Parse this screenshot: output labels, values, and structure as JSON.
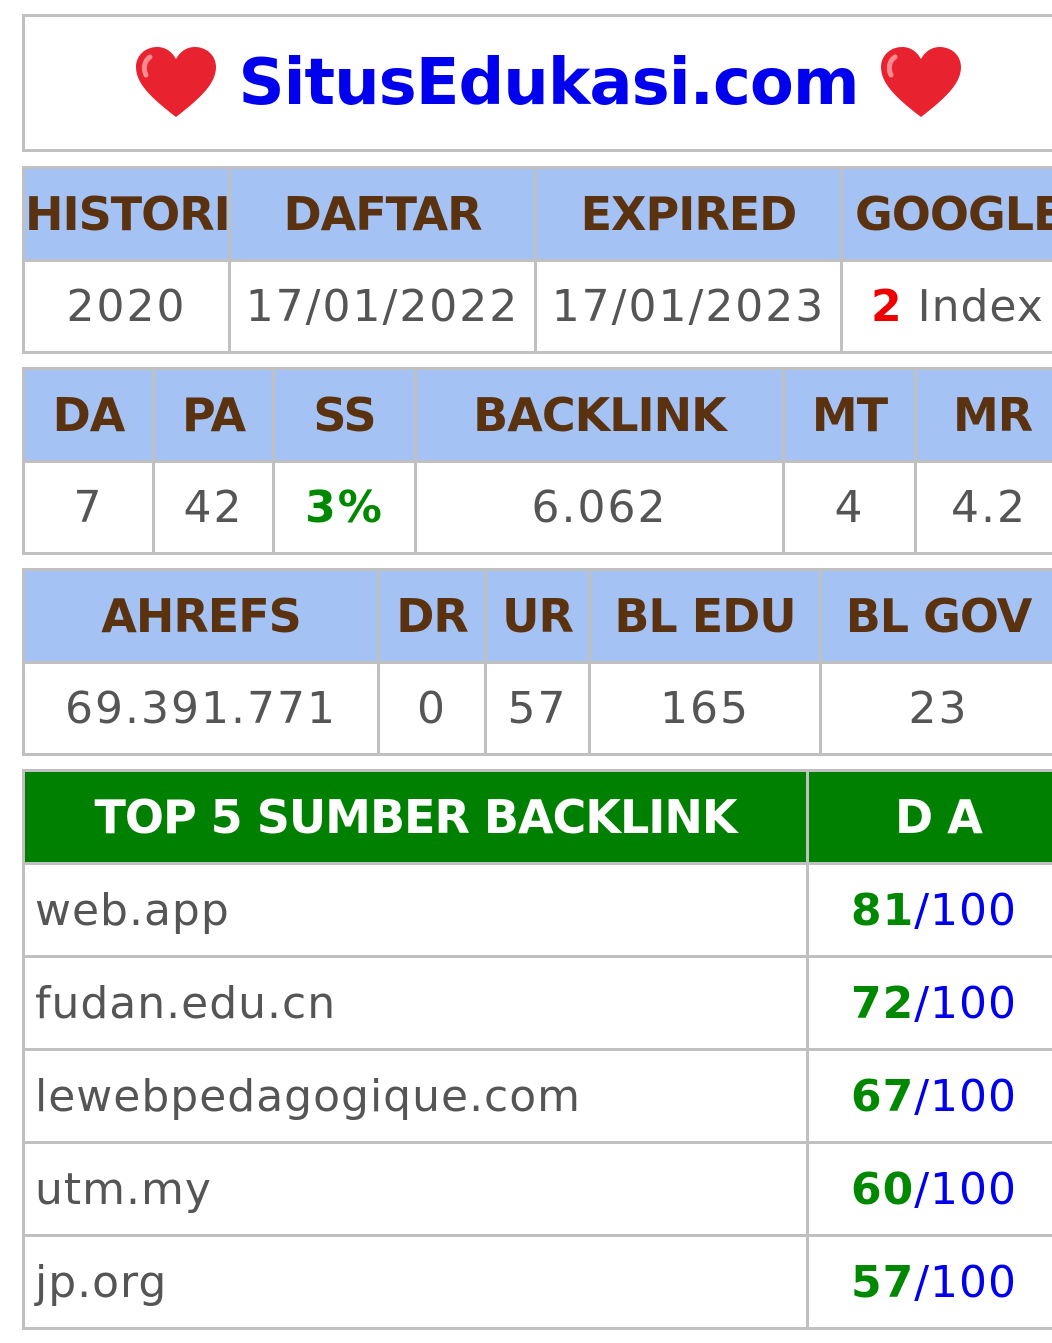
{
  "site_title": "SitusEdukasi.com",
  "colors": {
    "header_blue": "#a4c2f4",
    "header_text": "#5a3210",
    "title_blue": "#0000ee",
    "top5_green": "#008000",
    "accent_red": "#ee0000",
    "accent_green": "#008800"
  },
  "history_table": {
    "headers": [
      "HISTORI",
      "DAFTAR",
      "EXPIRED",
      "GOOGLE"
    ],
    "values": {
      "histori": "2020",
      "daftar": "17/01/2022",
      "expired": "17/01/2023",
      "google_count": "2",
      "google_suffix": " Index"
    }
  },
  "moz_table": {
    "headers": [
      "DA",
      "PA",
      "SS",
      "BACKLINK",
      "MT",
      "MR"
    ],
    "values": [
      "7",
      "42",
      "3%",
      "6.062",
      "4",
      "4.2"
    ]
  },
  "ahrefs_table": {
    "headers": [
      "AHREFS",
      "DR",
      "UR",
      "BL EDU",
      "BL GOV"
    ],
    "values": [
      "69.391.771",
      "0",
      "57",
      "165",
      "23"
    ]
  },
  "top5_table": {
    "headers": [
      "TOP 5 SUMBER BACKLINK",
      "D A"
    ],
    "rows": [
      {
        "site": "web.app",
        "score": "81",
        "max": "/100"
      },
      {
        "site": "fudan.edu.cn",
        "score": "72",
        "max": "/100"
      },
      {
        "site": "lewebpedagogique.com",
        "score": "67",
        "max": "/100"
      },
      {
        "site": "utm.my",
        "score": "60",
        "max": "/100"
      },
      {
        "site": "jp.org",
        "score": "57",
        "max": "/100"
      }
    ]
  }
}
